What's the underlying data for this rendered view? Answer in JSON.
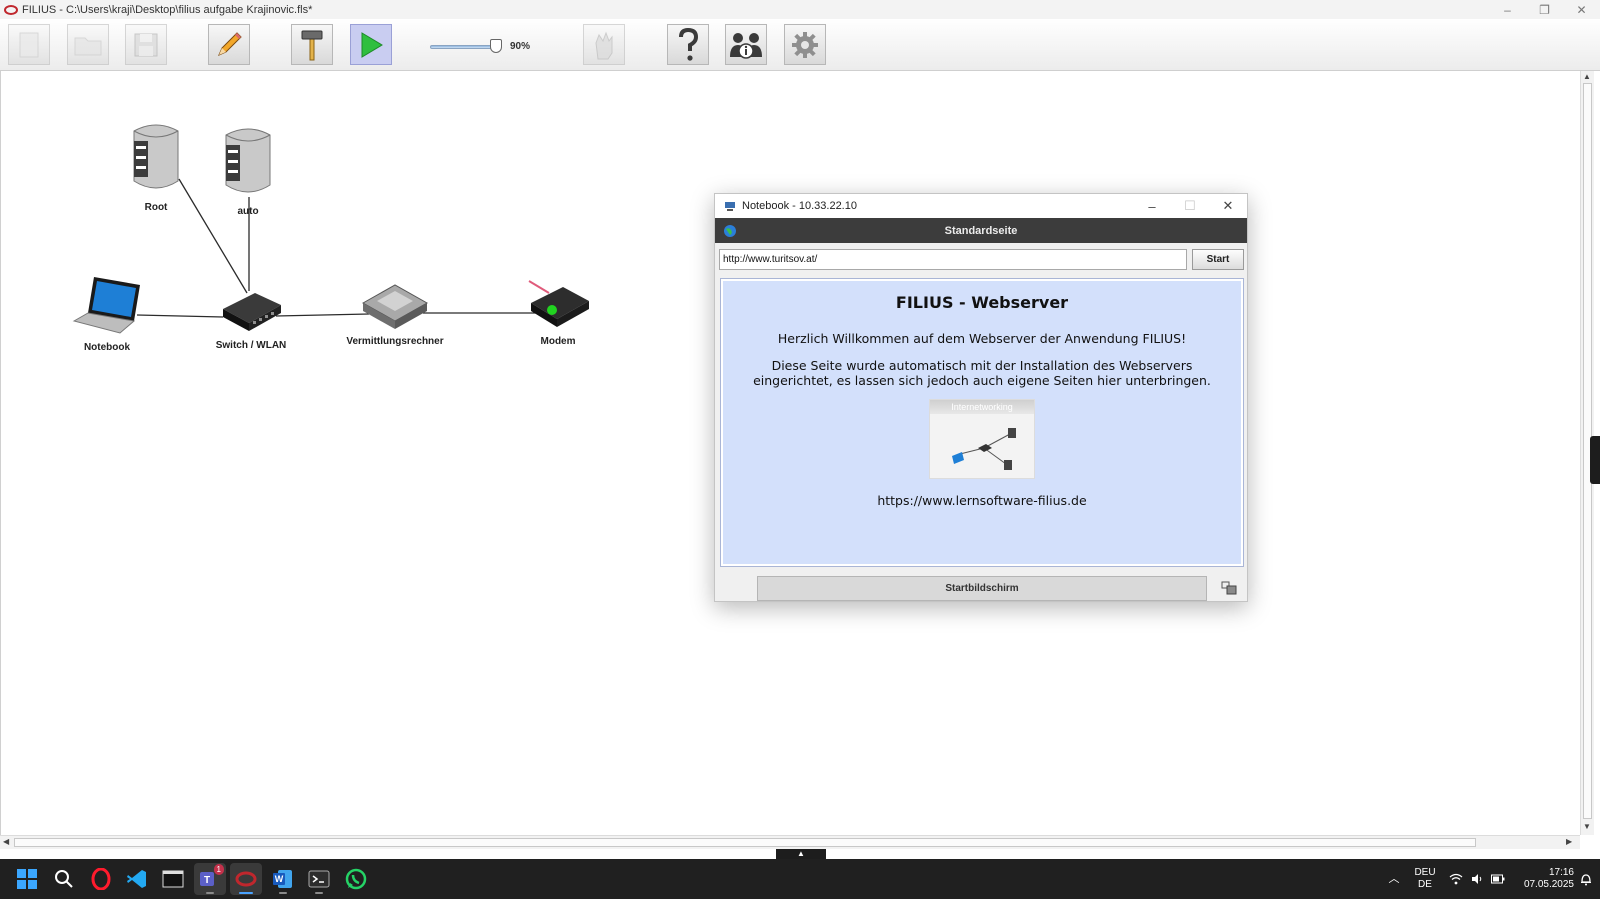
{
  "window": {
    "title": "FILIUS - C:\\Users\\kraji\\Desktop\\filius aufgabe Krajinovic.fls*",
    "controls": [
      "–",
      "❐",
      "✕"
    ]
  },
  "toolbar": {
    "buttons": [
      {
        "name": "new-file",
        "icon": "blank-page-icon",
        "enabled": false
      },
      {
        "name": "open-file",
        "icon": "folder-icon",
        "enabled": false
      },
      {
        "name": "save-file",
        "icon": "floppy-disk-icon",
        "enabled": false
      },
      {
        "name": "design-mode",
        "icon": "pencil-icon",
        "enabled": true
      },
      {
        "name": "simulation-mode",
        "icon": "hammer-icon",
        "enabled": true
      },
      {
        "name": "run",
        "icon": "play-icon",
        "enabled": true
      },
      {
        "name": "speed",
        "icon": "hand-icon",
        "enabled": false
      },
      {
        "name": "help",
        "icon": "question-mark-icon",
        "enabled": true
      },
      {
        "name": "info",
        "icon": "info-people-icon",
        "enabled": true
      },
      {
        "name": "settings",
        "icon": "gear-icon",
        "enabled": true
      }
    ],
    "zoom_value": "90%",
    "zoom_fraction": 0.9
  },
  "network": {
    "nodes": [
      {
        "id": "root",
        "label": "Root",
        "type": "server"
      },
      {
        "id": "auto",
        "label": "auto",
        "type": "server"
      },
      {
        "id": "notebook",
        "label": "Notebook",
        "type": "laptop"
      },
      {
        "id": "switch",
        "label": "Switch / WLAN",
        "type": "switch"
      },
      {
        "id": "router",
        "label": "Vermittlungsrechner",
        "type": "router"
      },
      {
        "id": "modem",
        "label": "Modem",
        "type": "modem"
      }
    ]
  },
  "dialog": {
    "title": "Notebook - 10.33.22.10",
    "header": "Standardseite",
    "url": "http://www.turitsov.at/",
    "start_label": "Start",
    "page": {
      "heading": "FILIUS - Webserver",
      "para1": "Herzlich Willkommen auf dem Webserver der Anwendung FILIUS!",
      "para2": "Diese Seite wurde automatisch mit der Installation des Webservers eingerichtet, es lassen sich jedoch auch eigene Seiten hier unterbringen.",
      "image_caption": "Internetworking",
      "link": "https://www.lernsoftware-filius.de"
    },
    "home_label": "Startbildschirm"
  },
  "taskbar": {
    "apps": [
      {
        "name": "start",
        "icon": "windows-logo-icon"
      },
      {
        "name": "search",
        "icon": "search-icon"
      },
      {
        "name": "opera",
        "icon": "opera-icon"
      },
      {
        "name": "vscode",
        "icon": "vscode-icon"
      },
      {
        "name": "terminal-window",
        "icon": "window-icon"
      },
      {
        "name": "teams",
        "icon": "teams-icon",
        "badge": "1"
      },
      {
        "name": "filius",
        "icon": "filius-icon"
      },
      {
        "name": "word",
        "icon": "word-icon"
      },
      {
        "name": "terminal",
        "icon": "terminal-icon"
      },
      {
        "name": "whatsapp",
        "icon": "whatsapp-icon"
      }
    ],
    "lang_top": "DEU",
    "lang_bottom": "DE",
    "time": "17:16",
    "date": "07.05.2025"
  },
  "colors": {
    "webview_bg": "#d3e0fb",
    "play_button_bg": "#c9cdf1",
    "taskbar_bg": "#202020",
    "dialog_header_bg": "#3c3c3c"
  }
}
